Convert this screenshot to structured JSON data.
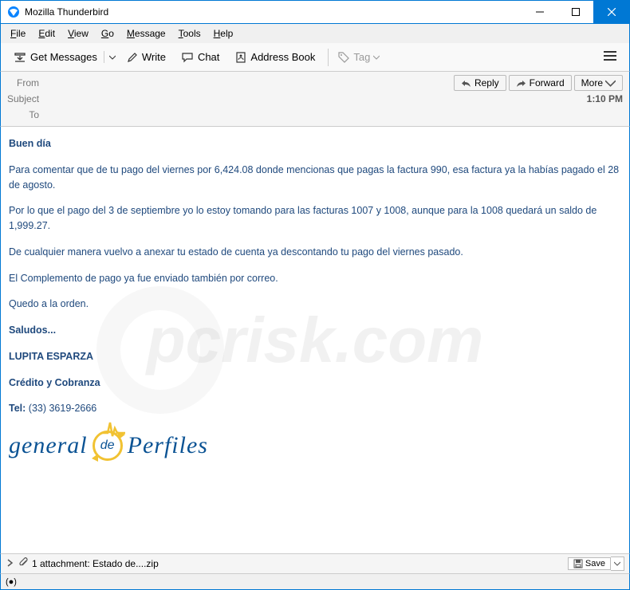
{
  "window": {
    "title": "Mozilla Thunderbird"
  },
  "menu": {
    "file": "File",
    "edit": "Edit",
    "view": "View",
    "go": "Go",
    "message": "Message",
    "tools": "Tools",
    "help": "Help"
  },
  "toolbar": {
    "get_messages": "Get Messages",
    "write": "Write",
    "chat": "Chat",
    "address_book": "Address Book",
    "tag": "Tag"
  },
  "header": {
    "from_label": "From",
    "subject_label": "Subject",
    "to_label": "To",
    "reply": "Reply",
    "forward": "Forward",
    "more": "More",
    "time": "1:10 PM"
  },
  "body": {
    "greeting": "Buen día",
    "p1": "Para comentar que de tu pago del viernes por  6,424.08 donde mencionas que pagas la factura 990, esa factura ya la habías pagado el 28 de agosto.",
    "p2": "Por lo que el pago del 3 de septiembre yo lo estoy tomando para las facturas 1007 y 1008, aunque para la 1008 quedará un saldo de 1,999.27.",
    "p3": "De cualquier manera vuelvo a anexar tu estado de cuenta ya descontando tu pago del viernes pasado.",
    "p4": "El Complemento de pago ya fue enviado también por correo.",
    "p5": "Quedo a la orden.",
    "saludos": "Saludos...",
    "name": "LUPITA ESPARZA",
    "dept": "Crédito y Cobranza",
    "tel_label": "Tel: ",
    "tel": "(33) 3619-2666",
    "logo1": "general",
    "logo_de": "de",
    "logo2": "Perfiles"
  },
  "attachment": {
    "text": "1 attachment: Estado de....zip",
    "save": "Save"
  },
  "watermark": "pcrisk.com"
}
